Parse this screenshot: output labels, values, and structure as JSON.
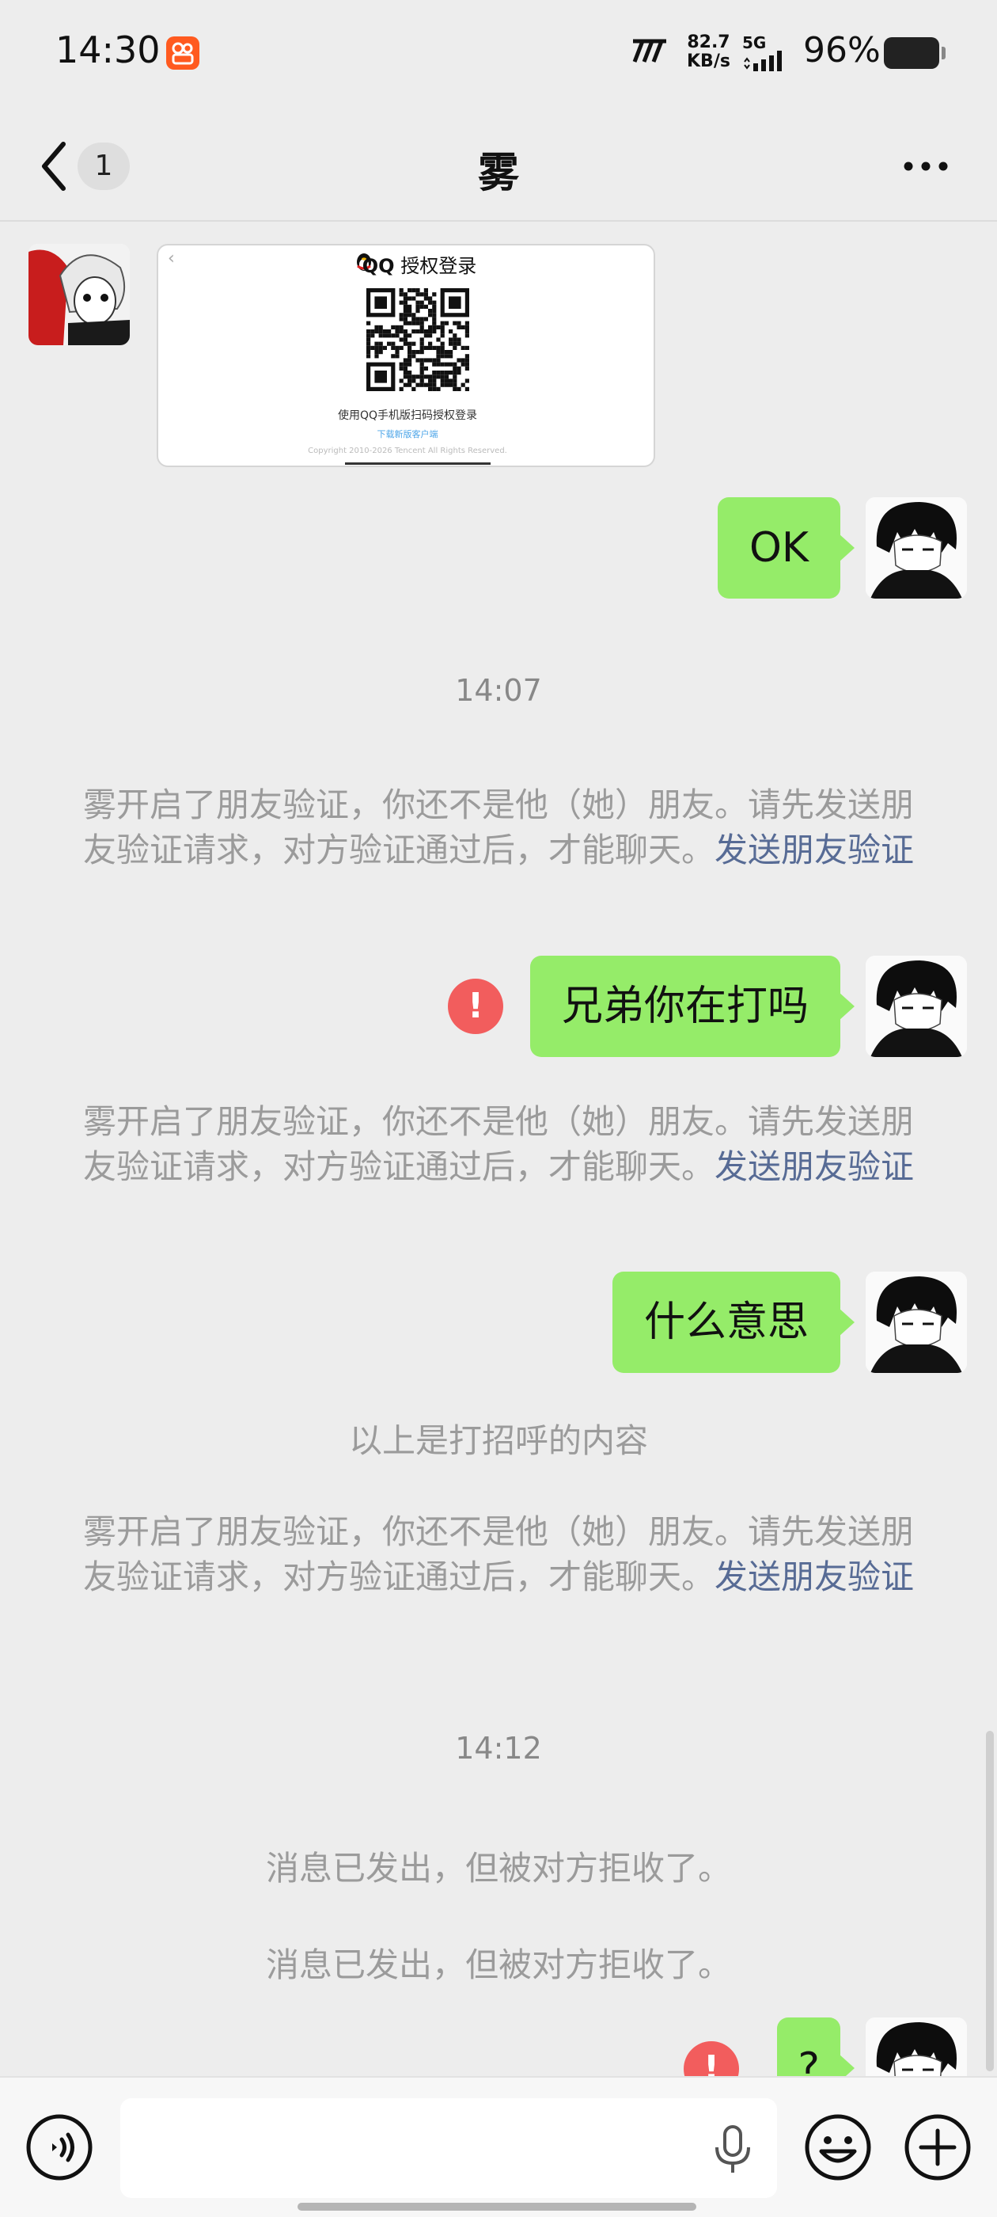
{
  "status_bar": {
    "time": "14:30",
    "net_speed_value": "82.7",
    "net_speed_unit": "KB/s",
    "network": "5G",
    "battery": "96%"
  },
  "header": {
    "unread_count": "1",
    "title": "雾"
  },
  "qr_card": {
    "title_brand": "QQ",
    "title_text": "授权登录",
    "caption": "使用QQ手机版扫码授权登录",
    "link": "下载新版客户端",
    "copyright": "Copyright 2010-2026 Tencent All Rights Reserved."
  },
  "messages": {
    "ok": "OK",
    "time_1": "14:07",
    "notice_text": "雾开启了朋友验证，你还不是他（她）朋友。请先发送朋友验证请求，对方验证通过后，才能聊天。",
    "notice_link": "发送朋友验证",
    "msg_1": "兄弟你在打吗",
    "msg_2": "什么意思",
    "greeting_note": "以上是打招呼的内容",
    "time_2": "14:12",
    "rejected": "消息已发出，但被对方拒收了。",
    "msg_3": "?",
    "error_mark": "!"
  },
  "input": {
    "value": "",
    "placeholder": ""
  },
  "colors": {
    "bubble_green": "#95ec69",
    "link_blue": "#576b95",
    "error_red": "#f25d5d",
    "background": "#ededed"
  },
  "icons": [
    "back-icon",
    "more-icon",
    "voice-icon",
    "mic-icon",
    "emoji-icon",
    "plus-icon",
    "error-icon"
  ]
}
